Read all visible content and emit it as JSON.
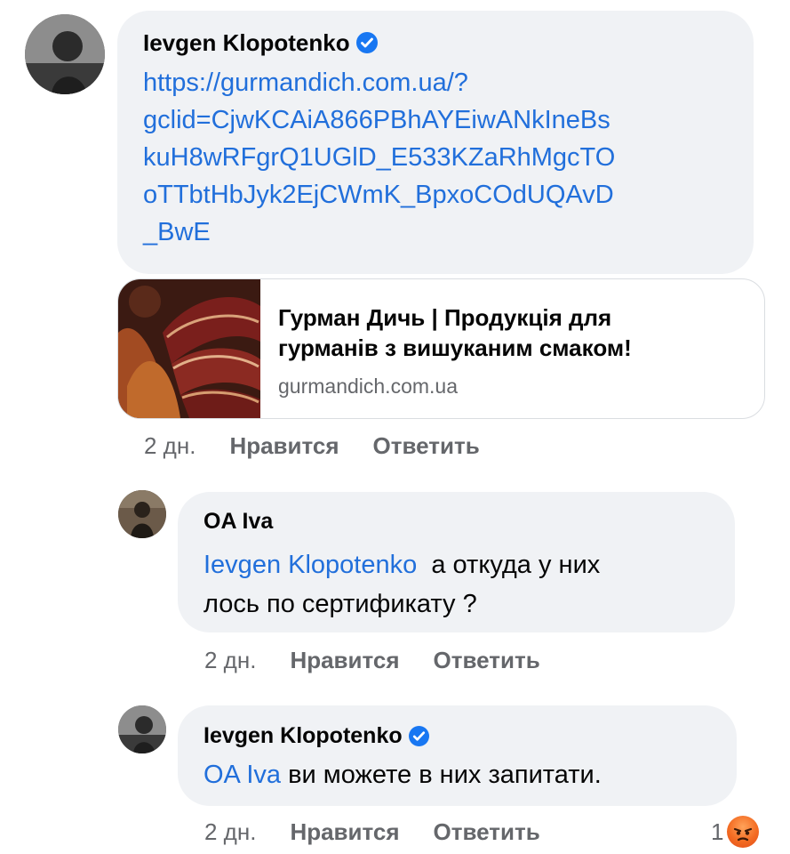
{
  "comments": [
    {
      "author": "Ievgen Klopotenko",
      "verified": true,
      "link_text": "https://gurmandich.com.ua/?gclid=CjwKCAiA866PBhAYEiwANkIneBskuH8wRFgrQ1UGlD_E533KZaRhMgcTOoTTbtHbJyk2EjCWmK_BpxoCOdUQAvD_BwE",
      "link_lines": [
        "https://gurmandich.com.ua/?",
        "gclid=CjwKCAiA866PBhAYEiwANkIneBs",
        "kuH8wRFgrQ1UGlD_E533KZaRhMgcTO",
        "oTTbtHbJyk2EjCWmK_BpxoCOdUQAvD",
        "_BwE"
      ],
      "preview": {
        "title_line1": "Гурман Дичь | Продукція для",
        "title_line2": "гурманів з вишуканим смаком!",
        "domain": "gurmandich.com.ua"
      },
      "time": "2 дн.",
      "like_label": "Нравится",
      "reply_label": "Ответить"
    },
    {
      "author": "OA Iva",
      "verified": false,
      "mention": "Ievgen Klopotenko",
      "text_line1": "а откуда у них",
      "text_line2": "лось по сертификату ?",
      "time": "2 дн.",
      "like_label": "Нравится",
      "reply_label": "Ответить"
    },
    {
      "author": "Ievgen Klopotenko",
      "verified": true,
      "mention": "OA Iva",
      "text": "ви можете в них запитати.",
      "time": "2 дн.",
      "like_label": "Нравится",
      "reply_label": "Ответить",
      "reaction_count": "1",
      "reaction_icon": "angry-reaction-icon"
    }
  ],
  "colors": {
    "link": "#216fdb",
    "bubble": "#f0f2f5",
    "meta": "#65676b",
    "verified": "#1877f2"
  }
}
